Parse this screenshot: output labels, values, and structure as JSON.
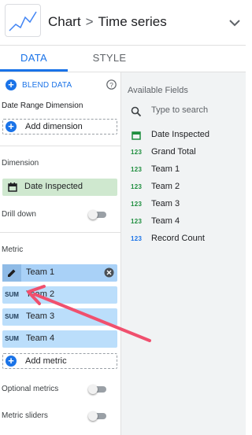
{
  "header": {
    "breadcrumb_root": "Chart",
    "breadcrumb_separator": ">",
    "breadcrumb_current": "Time series"
  },
  "tabs": [
    {
      "label": "DATA",
      "active": true
    },
    {
      "label": "STYLE",
      "active": false
    }
  ],
  "data_panel": {
    "blend_label": "BLEND DATA",
    "date_range_label": "Date Range Dimension",
    "add_dimension_label": "Add dimension",
    "dimension_section_label": "Dimension",
    "dimension_value": "Date Inspected",
    "drill_down_label": "Drill down",
    "drill_down_on": false,
    "metric_section_label": "Metric",
    "metrics": [
      {
        "aggregation": "",
        "name": "Team 1",
        "editing": true
      },
      {
        "aggregation": "SUM",
        "name": "Team 2",
        "editing": false
      },
      {
        "aggregation": "SUM",
        "name": "Team 3",
        "editing": false
      },
      {
        "aggregation": "SUM",
        "name": "Team 4",
        "editing": false
      }
    ],
    "add_metric_label": "Add metric",
    "optional_metrics_label": "Optional metrics",
    "optional_metrics_on": false,
    "metric_sliders_label": "Metric sliders",
    "metric_sliders_on": false
  },
  "fields_panel": {
    "title": "Available Fields",
    "search_placeholder": "Type to search",
    "fields": [
      {
        "type": "date",
        "type_label": "",
        "name": "Date Inspected"
      },
      {
        "type": "number",
        "type_label": "123",
        "name": "Grand Total"
      },
      {
        "type": "number",
        "type_label": "123",
        "name": "Team 1"
      },
      {
        "type": "number",
        "type_label": "123",
        "name": "Team 2"
      },
      {
        "type": "number",
        "type_label": "123",
        "name": "Team 3"
      },
      {
        "type": "number",
        "type_label": "123",
        "name": "Team 4"
      },
      {
        "type": "count",
        "type_label": "123",
        "name": "Record Count"
      }
    ]
  },
  "colors": {
    "accent": "#1a73e8",
    "dimension_chip": "#cfe8cf",
    "metric_chip": "#bbdefb",
    "annotation_arrow": "#f0506e"
  },
  "icons": {
    "header": [
      "line-chart-icon",
      "chevron-down-icon"
    ],
    "data_panel": [
      "plus-circle-icon",
      "help-circle-icon",
      "calendar-icon",
      "pencil-icon",
      "close-circle-icon"
    ],
    "fields_panel": [
      "search-icon",
      "calendar-icon"
    ]
  }
}
